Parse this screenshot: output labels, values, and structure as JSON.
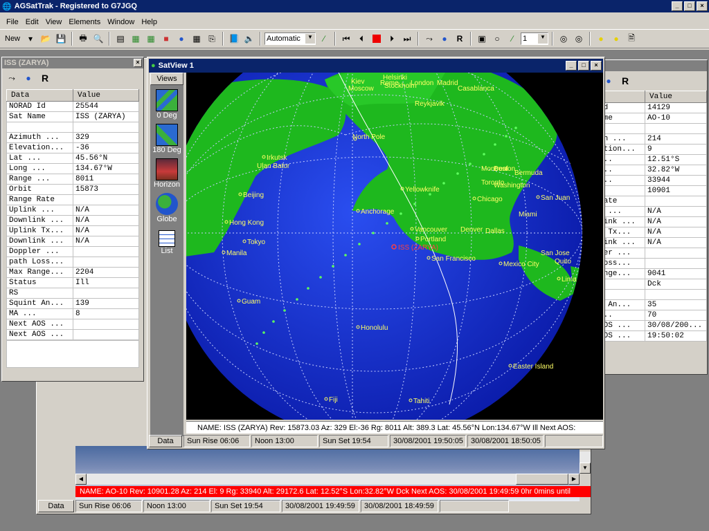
{
  "app": {
    "title": "AGSatTrak - Registered to G7JGQ",
    "menu": [
      "File",
      "Edit",
      "View",
      "Elements",
      "Window",
      "Help"
    ],
    "toolbar": {
      "new_label": "New",
      "mode_value": "Automatic",
      "count_value": "1"
    }
  },
  "iss_panel": {
    "title": "ISS (ZARYA)",
    "col_data": "Data",
    "col_value": "Value",
    "rows": [
      {
        "k": "NORAD Id",
        "v": "25544"
      },
      {
        "k": "Sat Name",
        "v": "ISS (ZARYA)"
      },
      {
        "k": "",
        "v": ""
      },
      {
        "k": "Azimuth  ...",
        "v": "329"
      },
      {
        "k": "Elevation...",
        "v": "-36"
      },
      {
        "k": "Lat      ...",
        "v": "45.56°N"
      },
      {
        "k": "Long     ...",
        "v": "134.67°W"
      },
      {
        "k": "Range    ...",
        "v": "8011"
      },
      {
        "k": "Orbit",
        "v": "15873"
      },
      {
        "k": "Range Rate",
        "v": ""
      },
      {
        "k": "Uplink   ...",
        "v": "N/A"
      },
      {
        "k": "Downlink ...",
        "v": "N/A"
      },
      {
        "k": "Uplink Tx...",
        "v": "N/A"
      },
      {
        "k": "Downlink ...",
        "v": "N/A"
      },
      {
        "k": "Doppler  ...",
        "v": ""
      },
      {
        "k": "path Loss...",
        "v": ""
      },
      {
        "k": "Max Range...",
        "v": "2204"
      },
      {
        "k": "Status",
        "v": "Ill"
      },
      {
        "k": "RS",
        "v": ""
      },
      {
        "k": "Squint An...",
        "v": "139"
      },
      {
        "k": "MA       ...",
        "v": "8"
      },
      {
        "k": "Next AOS ...",
        "v": ""
      },
      {
        "k": "Next AOS ...",
        "v": ""
      }
    ]
  },
  "ao10_panel": {
    "col_value": "Value",
    "rows": [
      {
        "k": " Id",
        "v": "14129"
      },
      {
        "k": "ame",
        "v": "AO-10"
      },
      {
        "k": "",
        "v": ""
      },
      {
        "k": "th  ...",
        "v": "214"
      },
      {
        "k": "ation...",
        "v": "9"
      },
      {
        "k": "    ...",
        "v": "12.51°S"
      },
      {
        "k": "    ...",
        "v": "32.82°W"
      },
      {
        "k": "    ...",
        "v": "33944"
      },
      {
        "k": "",
        "v": "10901"
      },
      {
        "k": " Rate",
        "v": ""
      },
      {
        "k": "k   ...",
        "v": "N/A"
      },
      {
        "k": "link ...",
        "v": "N/A"
      },
      {
        "k": "k Tx...",
        "v": "N/A"
      },
      {
        "k": "link ...",
        "v": "N/A"
      },
      {
        "k": "ler  ...",
        "v": ""
      },
      {
        "k": "Loss...",
        "v": ""
      },
      {
        "k": "ange...",
        "v": "9041"
      },
      {
        "k": "s",
        "v": "Dck"
      },
      {
        "k": "",
        "v": ""
      },
      {
        "k": "t An...",
        "v": "35"
      },
      {
        "k": "    ...",
        "v": "70"
      },
      {
        "k": "AOS ...",
        "v": "30/08/200..."
      },
      {
        "k": "AOS ...",
        "v": "19:50:02"
      }
    ]
  },
  "satview": {
    "title": "SatView 1",
    "views_label": "Views",
    "views": [
      "0 Deg",
      "180 Deg",
      "Horizon",
      "Globe",
      "List"
    ],
    "info_line": "NAME: ISS (ZARYA)  Rev: 15873.03  Az: 329  El:-36  Rg: 8011  Alt: 389.3  Lat: 45.56°N  Lon:134.67°W   Ill Next AOS:",
    "data_button": "Data",
    "status": [
      "Sun Rise 06:06",
      "Noon 13:00",
      "Sun Set 19:54",
      "30/08/2001 19:50:05",
      "30/08/2001 18:50:05"
    ],
    "sat_label": "ISS (ZARYA)",
    "cities": [
      "Kiev",
      "Moscow",
      "Helsinki",
      "Stockholm",
      "Rome",
      "London",
      "Madrid",
      "Casablanca",
      "Reykjavik",
      "North Pole",
      "Irkutsk",
      "Ulan Bator",
      "Beijing",
      "Hong Kong",
      "Tokyo",
      "Manila",
      "Guam",
      "Montreal",
      "Boston",
      "Bermuda",
      "Toronto",
      "Washington",
      "Yellowknife",
      "Chicago",
      "San Juan",
      "Anchorage",
      "Miami",
      "Vancouver",
      "Denver",
      "Dallas",
      "Portland",
      "San Francisco",
      "Mexico City",
      "San Jose",
      "Quito",
      "Lima",
      "Honolulu",
      "Easter Island",
      "Fiji",
      "Tahiti"
    ]
  },
  "main_window": {
    "ticker": "NAME: AO-10  Rev: 10901.28  Az: 214  El: 9  Rg: 33940  Alt: 29172.6  Lat: 12.52°S  Lon:32.82°W   Dck Next AOS: 30/08/2001 19:49:59 0hr 0mins until",
    "data_button": "Data",
    "status": [
      "Sun Rise 06:06",
      "Noon 13:00",
      "Sun Set 19:54",
      "30/08/2001 19:49:59",
      "30/08/2001 18:49:59"
    ]
  }
}
